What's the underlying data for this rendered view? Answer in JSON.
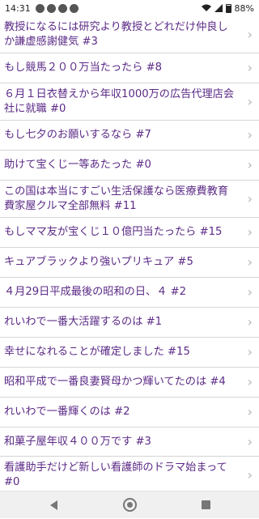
{
  "status": {
    "time": "14:31",
    "icons": [
      "notification-icon",
      "notification-icon",
      "notification-icon",
      "notification-icon"
    ],
    "battery": "88%"
  },
  "threads": [
    {
      "title": "教授になるには研究より教授とどれだけ仲良しか謙虚感謝健気 #3",
      "lines": 2
    },
    {
      "title": "もし競馬２００万当たったら #8",
      "lines": 1
    },
    {
      "title": "６月１日衣替えから年収1000万の広告代理店会社に就職 #0",
      "lines": 2
    },
    {
      "title": "もし七夕のお願いするなら #7",
      "lines": 1
    },
    {
      "title": "助けて宝くじ一等あたった #0",
      "lines": 1
    },
    {
      "title": "この国は本当にすごい生活保護なら医療費教育費家屋クルマ全部無料 #11",
      "lines": 2
    },
    {
      "title": "もしママ友が宝くじ１０億円当たったら #15",
      "lines": 1
    },
    {
      "title": "キュアブラックより強いプリキュア #5",
      "lines": 1
    },
    {
      "title": "４月29日平成最後の昭和の日、４ #2",
      "lines": 1
    },
    {
      "title": "れいわで一番大活躍するのは #1",
      "lines": 1
    },
    {
      "title": "幸せになれることが確定しました #15",
      "lines": 1
    },
    {
      "title": "昭和平成で一番良妻賢母かつ輝いてたのは #4",
      "lines": 1
    },
    {
      "title": "れいわで一番輝くのは #2",
      "lines": 1
    },
    {
      "title": "和菓子屋年収４００万です #3",
      "lines": 1
    },
    {
      "title": "看護助手だけど新しい看護師のドラマ始まって #0",
      "lines": 2
    }
  ],
  "chevron": "›"
}
